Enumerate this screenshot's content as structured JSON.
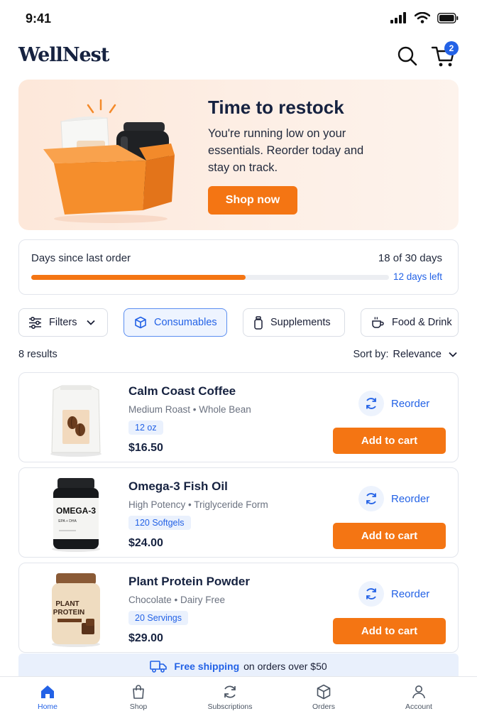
{
  "status": {
    "time": "9:41"
  },
  "header": {
    "logo": "WellNest",
    "cart_count": "2"
  },
  "promo": {
    "title": "Time to restock",
    "text": "You're running low on your essentials. Reorder today and stay on track.",
    "button": "Shop now"
  },
  "progress": {
    "label": "Days since last order",
    "count": "18 of 30 days",
    "days_left": "12 days left",
    "fraction": 0.6
  },
  "filters": {
    "filters_label": "Filters",
    "chips": [
      "Consumables",
      "Supplements",
      "Food & Drink"
    ],
    "active": "Consumables"
  },
  "results": {
    "count": "8 results",
    "sort_label": "Sort by:",
    "sort_value": "Relevance"
  },
  "products": [
    {
      "name": "Calm Coast Coffee",
      "subtitle": "Medium Roast • Whole Bean",
      "tag": "12 oz",
      "price": "$16.50",
      "reorder": "Reorder",
      "add": "Add to cart"
    },
    {
      "name": "Omega-3 Fish Oil",
      "subtitle": "High Potency • Triglyceride Form",
      "tag": "120 Softgels",
      "price": "$24.00",
      "reorder": "Reorder",
      "add": "Add to cart",
      "label_main": "OMEGA-3",
      "label_sub": "EPA + DHA"
    },
    {
      "name": "Plant Protein Powder",
      "subtitle": "Chocolate • Dairy Free",
      "tag": "20 Servings",
      "price": "$29.00",
      "reorder": "Reorder",
      "add": "Add to cart",
      "label_line1": "PLANT",
      "label_line2": "PROTEIN"
    }
  ],
  "shipping": {
    "highlight": "Free shipping",
    "text": "on orders over $50"
  },
  "tabs": [
    {
      "label": "Home",
      "icon": "home-icon"
    },
    {
      "label": "Shop",
      "icon": "bag-icon"
    },
    {
      "label": "Subscriptions",
      "icon": "refresh-icon"
    },
    {
      "label": "Orders",
      "icon": "box-icon"
    },
    {
      "label": "Account",
      "icon": "user-icon"
    }
  ],
  "colors": {
    "accent": "#f47513",
    "link": "#2362e6",
    "navy": "#162240",
    "promo_bg": "#fdefe6"
  }
}
